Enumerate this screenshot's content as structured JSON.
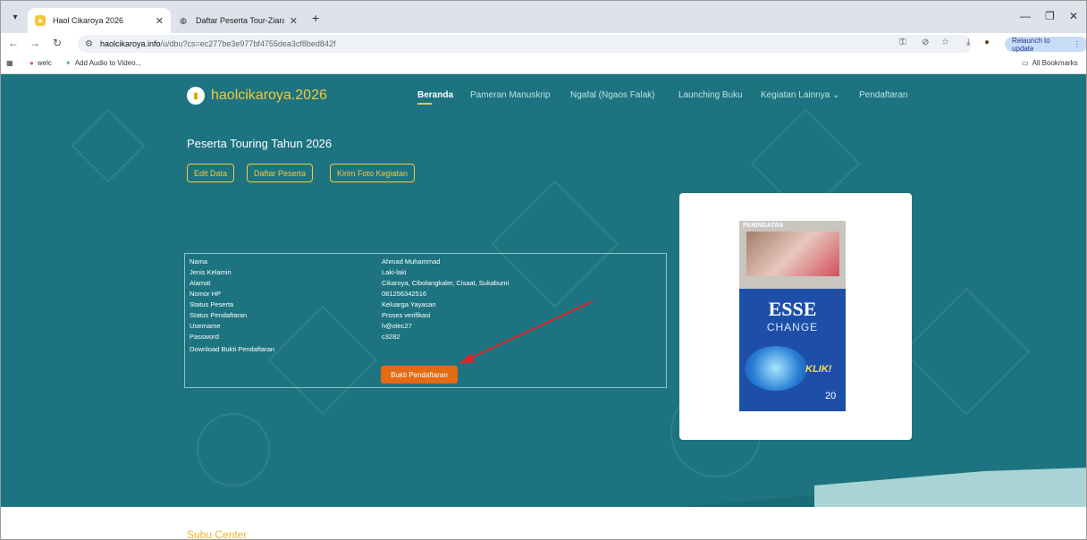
{
  "browser": {
    "tabs": [
      {
        "title": "Haol Cikaroya 2026",
        "active": true
      },
      {
        "title": "Daftar Peserta Tour-Ziarah Tahu",
        "active": false
      }
    ],
    "url_host": "haolcikaroya.info",
    "url_path": "/u/dbu?cs=ec277be3e977bf4755dea3cf8bed842f",
    "relaunch_label": "Relaunch to update",
    "bookmarks": [
      {
        "label": "welc"
      },
      {
        "label": "Add Audio to Video..."
      }
    ],
    "all_bookmarks_label": "All Bookmarks"
  },
  "site": {
    "logo_text": "haolcikaroya.2026",
    "nav": [
      {
        "label": "Beranda"
      },
      {
        "label": "Pameran Manuskrip"
      },
      {
        "label": "Ngafal (Ngaos Falak)"
      },
      {
        "label": "Launching Buku"
      },
      {
        "label": "Kegiatan Lainnya ⌄"
      },
      {
        "label": "Pendaftaran"
      }
    ],
    "page_title": "Peserta Touring Tahun 2026",
    "buttons": [
      {
        "label": "Edit Data"
      },
      {
        "label": "Daftar Peserta"
      },
      {
        "label": "Kirim Foto Kegiatan"
      }
    ],
    "info_rows": [
      {
        "label": "Nama",
        "value": "Ahmad Muhammad"
      },
      {
        "label": "Jenis Kelamin",
        "value": "Laki-laki"
      },
      {
        "label": "Alamat",
        "value": "Cikaroya, Cibolangkaler, Cisaat, Sukabumi"
      },
      {
        "label": "Nomor HP",
        "value": "081256342516"
      },
      {
        "label": "Status Peserta",
        "value": "Keluarga Yayasan"
      },
      {
        "label": "Status Pendaftaran",
        "value": "Proses verifikasi"
      },
      {
        "label": "Username",
        "value": "h@olec27"
      },
      {
        "label": "Password",
        "value": "c3282"
      }
    ],
    "download_label": "Download Bukti Pendaftaran",
    "download_button": "Bukti Pendaftaran",
    "photo": {
      "warning": "PERINGATAN",
      "brand": "ESSE",
      "sub": "CHANGE",
      "klik": "KLIK!",
      "count": "20"
    },
    "footer_title": "Subu Center"
  },
  "colors": {
    "hero_bg": "#1d7480",
    "accent": "#f5c83a",
    "button_orange": "#e46a14"
  }
}
